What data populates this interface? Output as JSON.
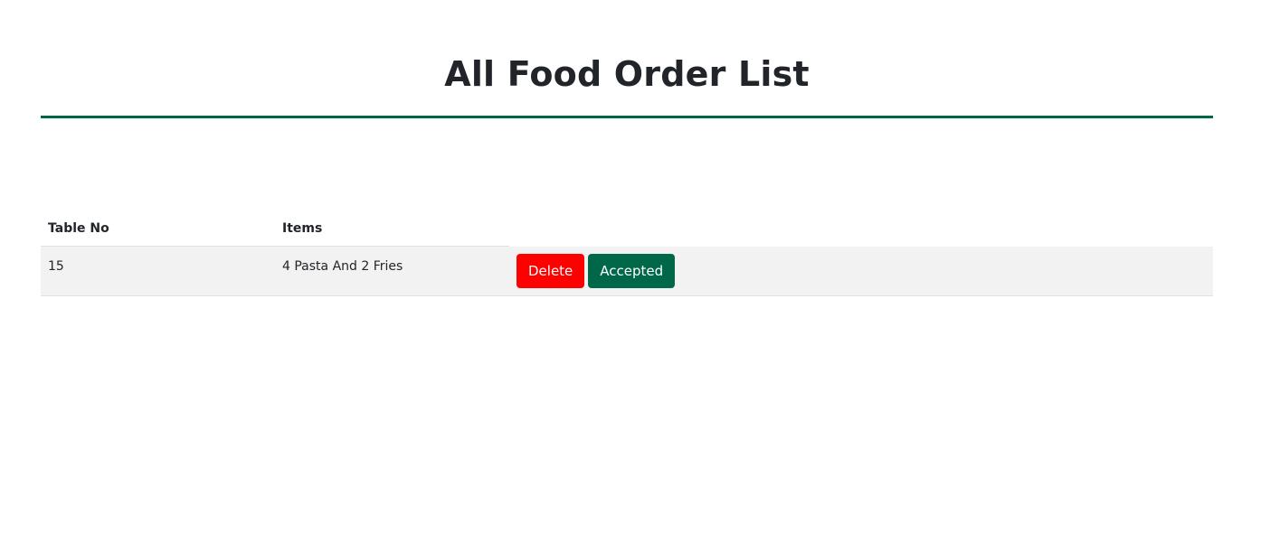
{
  "page": {
    "title": "All Food Order List"
  },
  "table": {
    "headers": {
      "table_no": "Table No",
      "items": "Items"
    },
    "rows": [
      {
        "table_no": "15",
        "items": "4 Pasta And 2 Fries",
        "delete_label": "Delete",
        "accepted_label": "Accepted"
      }
    ]
  },
  "colors": {
    "accent": "#006849",
    "delete": "#ff0000",
    "row_background": "#f2f2f2"
  }
}
